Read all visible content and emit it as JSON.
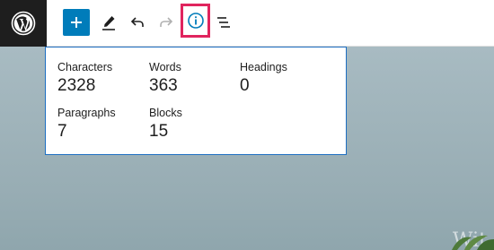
{
  "toolbar": {
    "logo_icon": "wordpress-icon",
    "buttons": [
      {
        "name": "add-block",
        "icon": "plus-icon"
      },
      {
        "name": "tools",
        "icon": "pencil-icon"
      },
      {
        "name": "undo",
        "icon": "undo-icon"
      },
      {
        "name": "redo",
        "icon": "redo-icon"
      },
      {
        "name": "details",
        "icon": "info-icon"
      },
      {
        "name": "outline",
        "icon": "list-view-icon"
      }
    ],
    "accent_color": "#007cba",
    "highlight_color": "#e0245e"
  },
  "info_panel": {
    "stats": [
      {
        "label": "Characters",
        "value": "2328"
      },
      {
        "label": "Words",
        "value": "363"
      },
      {
        "label": "Headings",
        "value": "0"
      },
      {
        "label": "Paragraphs",
        "value": "7"
      },
      {
        "label": "Blocks",
        "value": "15"
      }
    ]
  },
  "background": {
    "watermark_text": "Wit"
  }
}
